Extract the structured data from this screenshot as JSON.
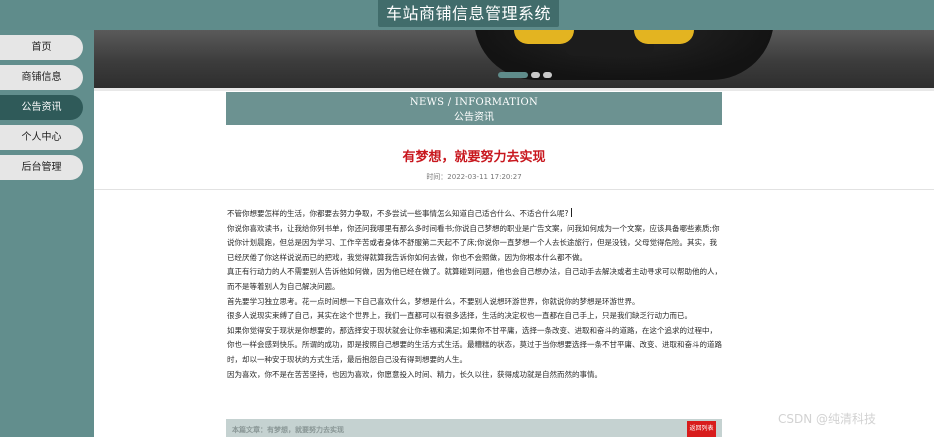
{
  "app": {
    "title": "车站商铺信息管理系统"
  },
  "sidebar": {
    "items": [
      {
        "label": "首页",
        "active": false
      },
      {
        "label": "商铺信息",
        "active": false
      },
      {
        "label": "公告资讯",
        "active": true
      },
      {
        "label": "个人中心",
        "active": false
      },
      {
        "label": "后台管理",
        "active": false
      }
    ]
  },
  "carousel": {
    "slide_count": 3,
    "active_index": 0
  },
  "news_header": {
    "en": "NEWS / INFORMATION",
    "cn": "公告资讯"
  },
  "article": {
    "title": "有梦想，就要努力去实现",
    "time": "时间：2022-03-11 17:20:27",
    "paragraphs": [
      "不管你想要怎样的生活，你都要去努力争取，不多尝试一些事情怎么知道自己适合什么、不适合什么呢?",
      "你说你喜欢读书，让我给你列书单，你还问我哪里有那么多时间看书;你说自己梦想的职业是广告文案，问我如何成为一个文案，应该具备哪些素质;你说你计划晨跑，但总是因为学习、工作辛苦或者身体不舒服第二天起不了床;你说你一直梦想一个人去长途旅行，但是没钱，父母觉得危险。其实，我已经厌倦了你这样说说而已的把戏，我觉得就算我告诉你如何去做，你也不会照做，因为你根本什么都不做。",
      "真正有行动力的人不需要别人告诉他如何做，因为他已经在做了。就算碰到问题，他也会自己想办法，自己动手去解决或者主动寻求可以帮助他的人，而不是等着别人为自己解决问题。",
      "首先要学习独立思考。花一点时间想一下自己喜欢什么，梦想是什么，不要别人说想环游世界，你就说你的梦想是环游世界。",
      "很多人说现实束缚了自己，其实在这个世界上，我们一直都可以有很多选择，生活的决定权也一直都在自己手上，只是我们缺乏行动力而已。",
      "如果你觉得安于现状是你想要的，那选择安于现状就会让你幸福和满足;如果你不甘平庸，选择一条改变、进取和奋斗的道路，在这个追求的过程中，你也一样会感到快乐。所谓的成功，即是按照自己想要的生活方式生活。最糟糕的状态，莫过于当你想要选择一条不甘平庸、改变、进取和奋斗的道路时，却以一种安于现状的方式生活，最后抱怨自己没有得到想要的人生。",
      "因为喜欢，你不是在苦苦坚持，也因为喜欢，你愿意投入时间、精力，长久以往，获得成功就是自然而然的事情。"
    ]
  },
  "recommend": {
    "text": "本篇文章：有梦想，就要努力去实现",
    "button": "返回列表"
  },
  "watermark": "CSDN @纯清科技",
  "colors": {
    "teal": "#5f8c8b",
    "dark_teal": "#2f5a59",
    "title_red": "#c8171e",
    "button_red": "#d81c1c"
  }
}
